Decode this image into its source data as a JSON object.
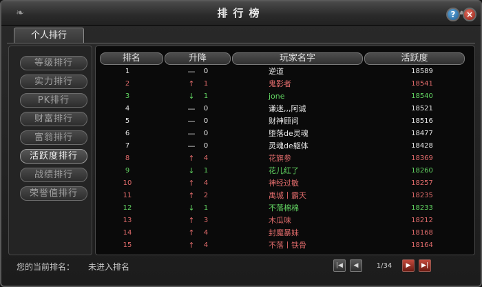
{
  "window": {
    "title": "排行榜",
    "help_label": "?",
    "close_label": "×"
  },
  "tabs": [
    {
      "label": "个人排行",
      "selected": true
    }
  ],
  "categories": [
    {
      "label": "等级排行"
    },
    {
      "label": "实力排行"
    },
    {
      "label": "PK排行"
    },
    {
      "label": "财富排行"
    },
    {
      "label": "富翁排行"
    },
    {
      "label": "活跃度排行",
      "selected": true
    },
    {
      "label": "战绩排行"
    },
    {
      "label": "荣誉值排行"
    }
  ],
  "table": {
    "headers": [
      "排名",
      "升降",
      "玩家名字",
      "活跃度"
    ],
    "rows": [
      {
        "rank": "1",
        "arrow": "—",
        "change": "0",
        "name": "逆道",
        "activity": "18589",
        "trend": "same"
      },
      {
        "rank": "2",
        "arrow": "↑",
        "change": "1",
        "name": "鬼影者",
        "activity": "18541",
        "trend": "up"
      },
      {
        "rank": "3",
        "arrow": "↓",
        "change": "1",
        "name": "jone",
        "activity": "18540",
        "trend": "down"
      },
      {
        "rank": "4",
        "arrow": "—",
        "change": "0",
        "name": "谦迷,,,阿诚",
        "activity": "18521",
        "trend": "same"
      },
      {
        "rank": "5",
        "arrow": "—",
        "change": "0",
        "name": "财神顾问",
        "activity": "18516",
        "trend": "same"
      },
      {
        "rank": "6",
        "arrow": "—",
        "change": "0",
        "name": "堕落de灵魂",
        "activity": "18477",
        "trend": "same"
      },
      {
        "rank": "7",
        "arrow": "—",
        "change": "0",
        "name": "灵魂de躯体",
        "activity": "18428",
        "trend": "same"
      },
      {
        "rank": "8",
        "arrow": "↑",
        "change": "4",
        "name": "花旗参",
        "activity": "18369",
        "trend": "up"
      },
      {
        "rank": "9",
        "arrow": "↓",
        "change": "1",
        "name": "花儿红了",
        "activity": "18260",
        "trend": "down"
      },
      {
        "rank": "10",
        "arrow": "↑",
        "change": "4",
        "name": "神经过敏",
        "activity": "18257",
        "trend": "up"
      },
      {
        "rank": "11",
        "arrow": "↑",
        "change": "2",
        "name": "禹城丨霸天",
        "activity": "18235",
        "trend": "up"
      },
      {
        "rank": "12",
        "arrow": "↓",
        "change": "1",
        "name": "不落棉棉",
        "activity": "18233",
        "trend": "down"
      },
      {
        "rank": "13",
        "arrow": "↑",
        "change": "3",
        "name": "木瓜味",
        "activity": "18212",
        "trend": "up"
      },
      {
        "rank": "14",
        "arrow": "↑",
        "change": "4",
        "name": "封魔暴妹",
        "activity": "18168",
        "trend": "up"
      },
      {
        "rank": "15",
        "arrow": "↑",
        "change": "4",
        "name": "不落丨铁骨",
        "activity": "18164",
        "trend": "up"
      }
    ]
  },
  "trend_colors": {
    "same": "#e6e6e6",
    "up": "#e06b6b",
    "down": "#62d462"
  },
  "footer": {
    "rank_label": "您的当前排名：",
    "rank_value": "未进入排名",
    "page": "1/34"
  },
  "pager": {
    "first_icon": "first-page-icon",
    "prev_icon": "prev-page-icon",
    "next_icon": "next-page-icon",
    "last_icon": "last-page-icon"
  }
}
